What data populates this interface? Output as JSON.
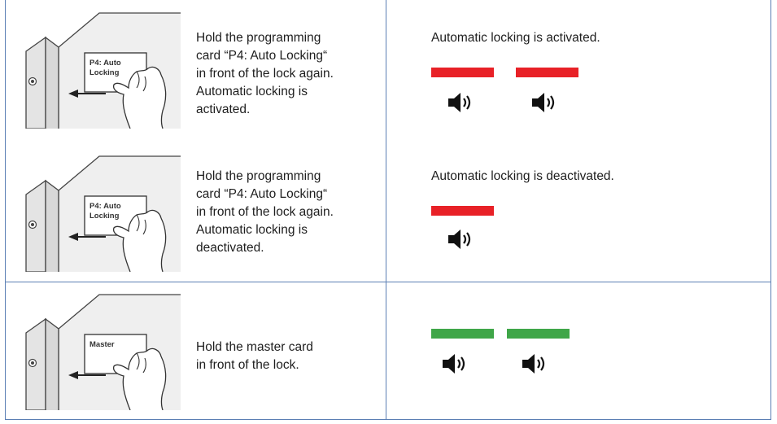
{
  "rows": [
    {
      "card_label_line1": "P4: Auto",
      "card_label_line2": "Locking",
      "instruction_lines": [
        "Hold the programming",
        "card “P4: Auto Locking“",
        "in front of the lock again.",
        "Automatic locking is",
        "activated."
      ],
      "result_text": "Automatic locking is activated.",
      "signal": {
        "color": "red",
        "count": 2
      }
    },
    {
      "card_label_line1": "P4: Auto",
      "card_label_line2": "Locking",
      "instruction_lines": [
        "Hold the programming",
        "card “P4: Auto Locking“",
        "in front of the lock again.",
        "Automatic locking is",
        "deactivated."
      ],
      "result_text": "Automatic locking is deactivated.",
      "signal": {
        "color": "red",
        "count": 1
      }
    },
    {
      "card_label_line1": "Master",
      "card_label_line2": "",
      "instruction_lines": [
        "Hold the master card",
        "in front of the lock."
      ],
      "result_text": "",
      "signal": {
        "color": "green",
        "count": 2
      }
    }
  ],
  "colors": {
    "red_led": "#e82127",
    "green_led": "#3fa648",
    "grid_line": "#5b7fb4"
  },
  "icons": {
    "signal_sound": "speaker-icon"
  }
}
